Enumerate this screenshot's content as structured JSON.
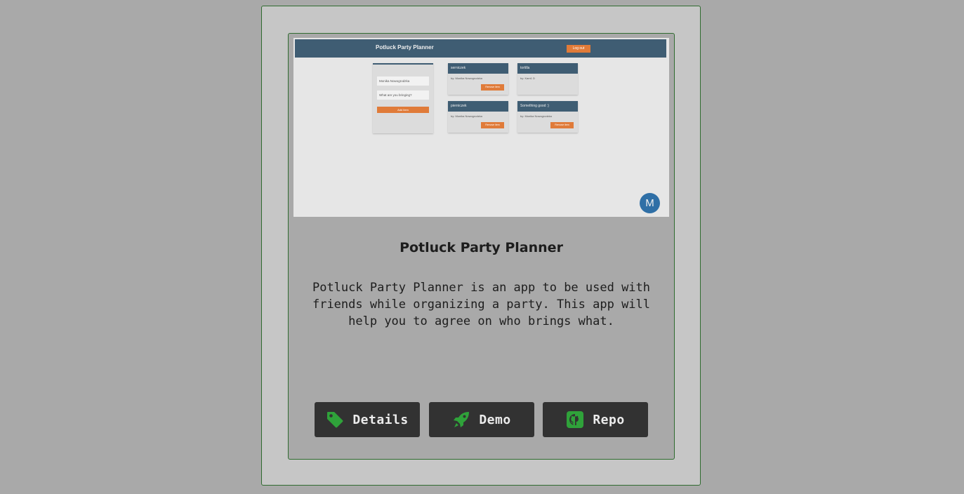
{
  "accent_color": "#2fa23a",
  "thumbnail": {
    "app_title": "Potluck Party Planner",
    "login_label": "Log out",
    "form": {
      "name_value": "Monika Nowogrodzka",
      "item_placeholder": "What are you bringing?",
      "add_label": "Add item"
    },
    "items": [
      {
        "name": "serniczek",
        "by": "by: Monika Nowogrodzka",
        "remove_label": "Remove item",
        "has_remove": true
      },
      {
        "name": "tortilla",
        "by": "by: Kam1 D",
        "remove_label": "",
        "has_remove": false
      },
      {
        "name": "pierniczek",
        "by": "by: Monika Nowogrodzka",
        "remove_label": "Remove item",
        "has_remove": true
      },
      {
        "name": "Something good :)",
        "by": "by: Monika Nowogrodzka",
        "remove_label": "Remove item",
        "has_remove": true
      }
    ],
    "avatar_letter": "M"
  },
  "project": {
    "title": "Potluck Party Planner",
    "description": "Potluck Party Planner is an app to be used with friends while organizing a party. This app will help you to agree on who brings what."
  },
  "buttons": [
    {
      "label": "Details",
      "icon": "tag-icon"
    },
    {
      "label": "Demo",
      "icon": "rocket-icon"
    },
    {
      "label": "Repo",
      "icon": "github-icon"
    }
  ]
}
